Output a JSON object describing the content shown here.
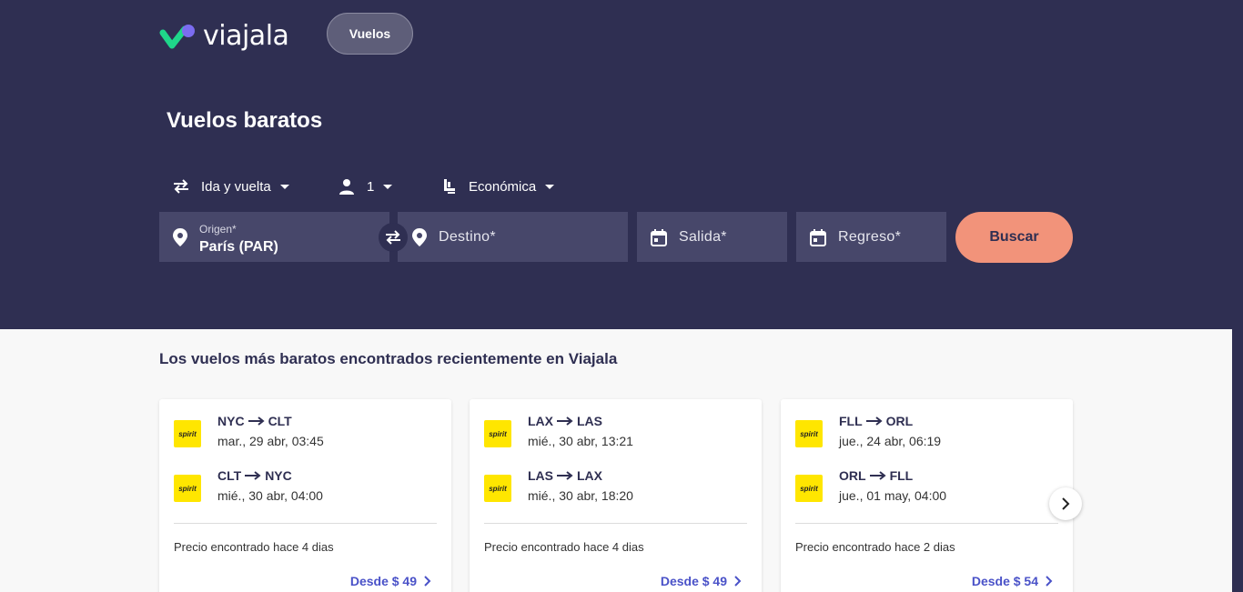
{
  "brand": {
    "name": "viajala"
  },
  "nav": {
    "flights_label": "Vuelos"
  },
  "hero": {
    "title": "Vuelos baratos"
  },
  "options": {
    "trip_type": "Ida y vuelta",
    "passengers": "1",
    "cabin": "Económica"
  },
  "search": {
    "origin_label": "Origen*",
    "origin_value": "París (PAR)",
    "destination_placeholder": "Destino*",
    "departure_placeholder": "Salida*",
    "return_placeholder": "Regreso*",
    "button_label": "Buscar"
  },
  "deals": {
    "title": "Los vuelos más baratos encontrados recientemente en Viajala",
    "cards": [
      {
        "legs": [
          {
            "airline": "spirit",
            "from": "NYC",
            "to": "CLT",
            "date": "mar., 29 abr, 03:45"
          },
          {
            "airline": "spirit",
            "from": "CLT",
            "to": "NYC",
            "date": "mié., 30 abr, 04:00"
          }
        ],
        "found": "Precio encontrado hace 4 dias",
        "price": "Desde $ 49"
      },
      {
        "legs": [
          {
            "airline": "spirit",
            "from": "LAX",
            "to": "LAS",
            "date": "mié., 30 abr, 13:21"
          },
          {
            "airline": "spirit",
            "from": "LAS",
            "to": "LAX",
            "date": "mié., 30 abr, 18:20"
          }
        ],
        "found": "Precio encontrado hace 4 dias",
        "price": "Desde $ 49"
      },
      {
        "legs": [
          {
            "airline": "spirit",
            "from": "FLL",
            "to": "ORL",
            "date": "jue., 24 abr, 06:19"
          },
          {
            "airline": "spirit",
            "from": "ORL",
            "to": "FLL",
            "date": "jue., 01 may, 04:00"
          }
        ],
        "found": "Precio encontrado hace 2 dias",
        "price": "Desde $ 54"
      }
    ]
  },
  "colors": {
    "hero_bg": "#2f2f52",
    "field_bg": "#47476a",
    "accent_button": "#f2937a",
    "price_link": "#4a52c8",
    "airline_badge": "#ffe600",
    "logo_green": "#1fd68a",
    "logo_purple": "#7b6cf0"
  },
  "icons": [
    "heart-logo-icon",
    "swap-arrows-icon",
    "person-icon",
    "seat-icon",
    "location-pin-icon",
    "calendar-icon",
    "chevron-right-icon",
    "chevron-down-icon",
    "arrow-right-icon"
  ]
}
